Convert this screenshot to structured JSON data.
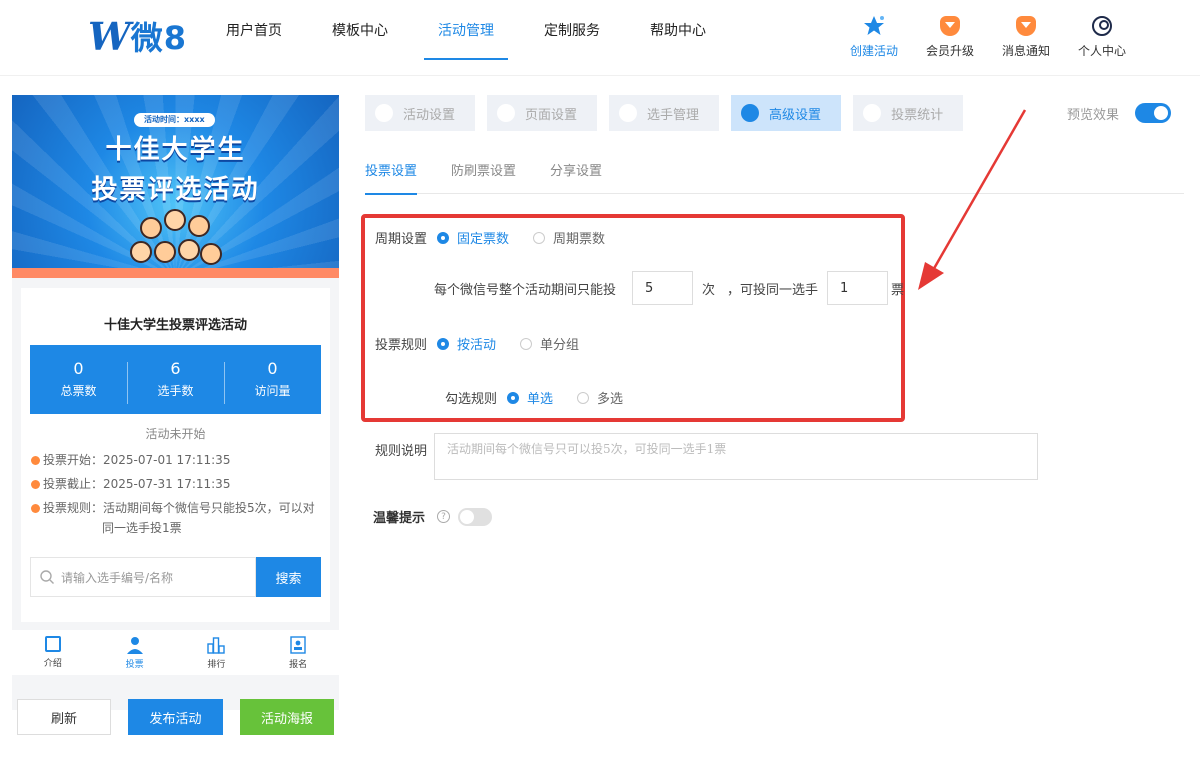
{
  "brand": {
    "logo_mark": "W",
    "logo_text": "微8"
  },
  "nav": {
    "items": [
      {
        "label": "用户首页"
      },
      {
        "label": "模板中心"
      },
      {
        "label": "活动管理"
      },
      {
        "label": "定制服务"
      },
      {
        "label": "帮助中心"
      }
    ],
    "active": "活动管理"
  },
  "tools": [
    {
      "label": "创建活动",
      "icon": "star-icon"
    },
    {
      "label": "会员升级",
      "icon": "vip-shield-icon"
    },
    {
      "label": "消息通知",
      "icon": "bell-shield-icon"
    },
    {
      "label": "个人中心",
      "icon": "user-circle-icon"
    }
  ],
  "preview": {
    "banner": {
      "time_pill": "活动时间：xxxx",
      "title_line1": "十佳大学生",
      "title_line2": "投票评选活动"
    },
    "card_title": "十佳大学生投票评选活动",
    "stats": [
      {
        "num": "0",
        "label": "总票数"
      },
      {
        "num": "6",
        "label": "选手数"
      },
      {
        "num": "0",
        "label": "访问量"
      }
    ],
    "status": "活动未开始",
    "info": [
      "投票开始：2025-07-01 17:11:35",
      "投票截止：2025-07-31 17:11:35",
      "投票规则：活动期间每个微信号只能投5次，可以对同一选手投1票"
    ],
    "search_placeholder": "请输入选手编号/名称",
    "search_button": "搜索",
    "tabbar": [
      {
        "label": "介绍"
      },
      {
        "label": "投票"
      },
      {
        "label": "排行"
      },
      {
        "label": "报名"
      }
    ]
  },
  "buttons": {
    "refresh": "刷新",
    "publish": "发布活动",
    "poster": "活动海报"
  },
  "settings_tabs": [
    {
      "label": "活动设置"
    },
    {
      "label": "页面设置"
    },
    {
      "label": "选手管理"
    },
    {
      "label": "高级设置"
    },
    {
      "label": "投票统计"
    }
  ],
  "preview_toggle": {
    "label": "预览效果",
    "on": true
  },
  "sub_tabs": [
    {
      "label": "投票设置"
    },
    {
      "label": "防刷票设置"
    },
    {
      "label": "分享设置"
    }
  ],
  "form": {
    "cycle_label": "周期设置",
    "cycle_options": [
      "固定票数",
      "周期票数"
    ],
    "limit_prefix": "每个微信号整个活动期间只能投",
    "limit_value": "5",
    "limit_unit": "次",
    "same_prefix": "，可投同一选手",
    "same_value": "1",
    "same_unit": "票",
    "rule_label": "投票规则",
    "rule_options": [
      "按活动",
      "单分组"
    ],
    "select_label": "勾选规则",
    "select_options": [
      "单选",
      "多选"
    ],
    "desc_label": "规则说明",
    "desc_placeholder": "活动期间每个微信号只可以投5次，可投同一选手1票",
    "tip_label": "温馨提示",
    "tip_icon": "?"
  },
  "colors": {
    "accent": "#1e88e5",
    "highlight": "#e53935",
    "poster": "#67c23a",
    "dot": "#ff8a3d"
  }
}
